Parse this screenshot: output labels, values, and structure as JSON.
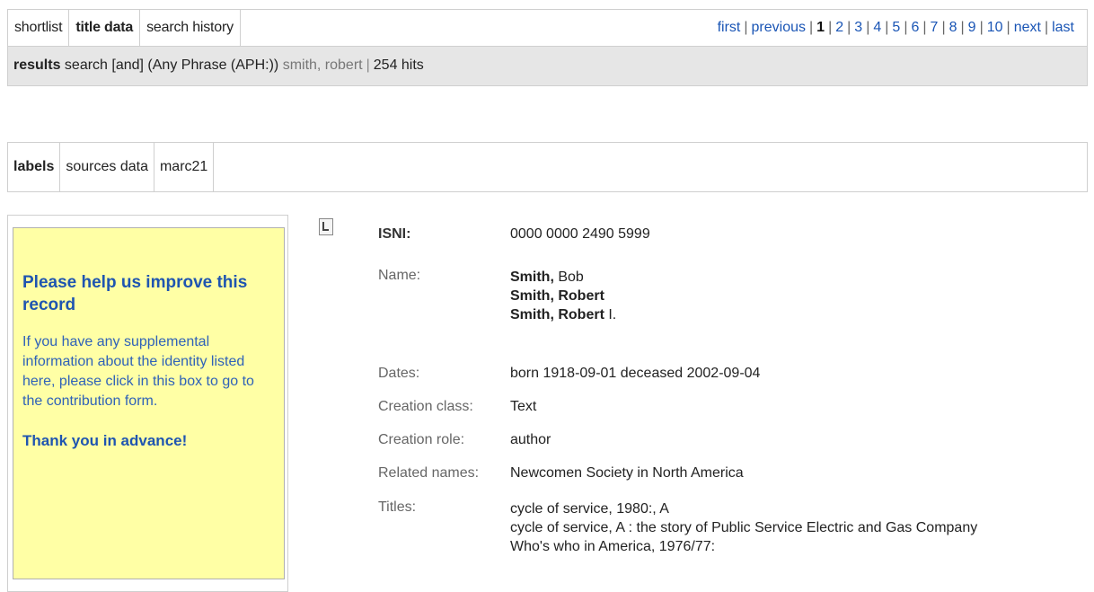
{
  "tabs": [
    "shortlist",
    "title data",
    "search history"
  ],
  "pager": {
    "first": "first",
    "previous": "previous",
    "current": "1",
    "pages": [
      "2",
      "3",
      "4",
      "5",
      "6",
      "7",
      "8",
      "9",
      "10"
    ],
    "next": "next",
    "last": "last"
  },
  "results": {
    "label": "results",
    "query_prefix": "search [and] (Any Phrase (APH:))",
    "term": "smith, robert",
    "hits": "254 hits"
  },
  "view_tabs": [
    "labels",
    "sources data",
    "marc21"
  ],
  "help_box": {
    "title": "Please help us improve this record",
    "body": "If you have any supplemental information about the identity listed here, please click in this box to go to the contribution form.",
    "thanks": "Thank you in advance!"
  },
  "record": {
    "isni_label": "ISNI:",
    "isni_value": "0000 0000 2490 5999",
    "name_label": "Name:",
    "names": [
      {
        "surname": "Smith,",
        "given": "Bob",
        "given_bold": false
      },
      {
        "surname": "Smith,",
        "given": "Robert",
        "given_bold": true
      },
      {
        "surname": "Smith, Robert",
        "given": "I.",
        "given_bold": false
      }
    ],
    "dates_label": "Dates:",
    "dates_value": "born 1918-09-01 deceased 2002-09-04",
    "creation_class_label": "Creation class:",
    "creation_class_value": "Text",
    "creation_role_label": "Creation role:",
    "creation_role_value": "author",
    "related_names_label": "Related names:",
    "related_names_value": "Newcomen Society in North America",
    "titles_label": "Titles:",
    "titles": [
      "cycle of service, 1980:, A",
      "cycle of service, A : the story of Public Service Electric and Gas Company",
      "Who's who in America, 1976/77:"
    ]
  }
}
